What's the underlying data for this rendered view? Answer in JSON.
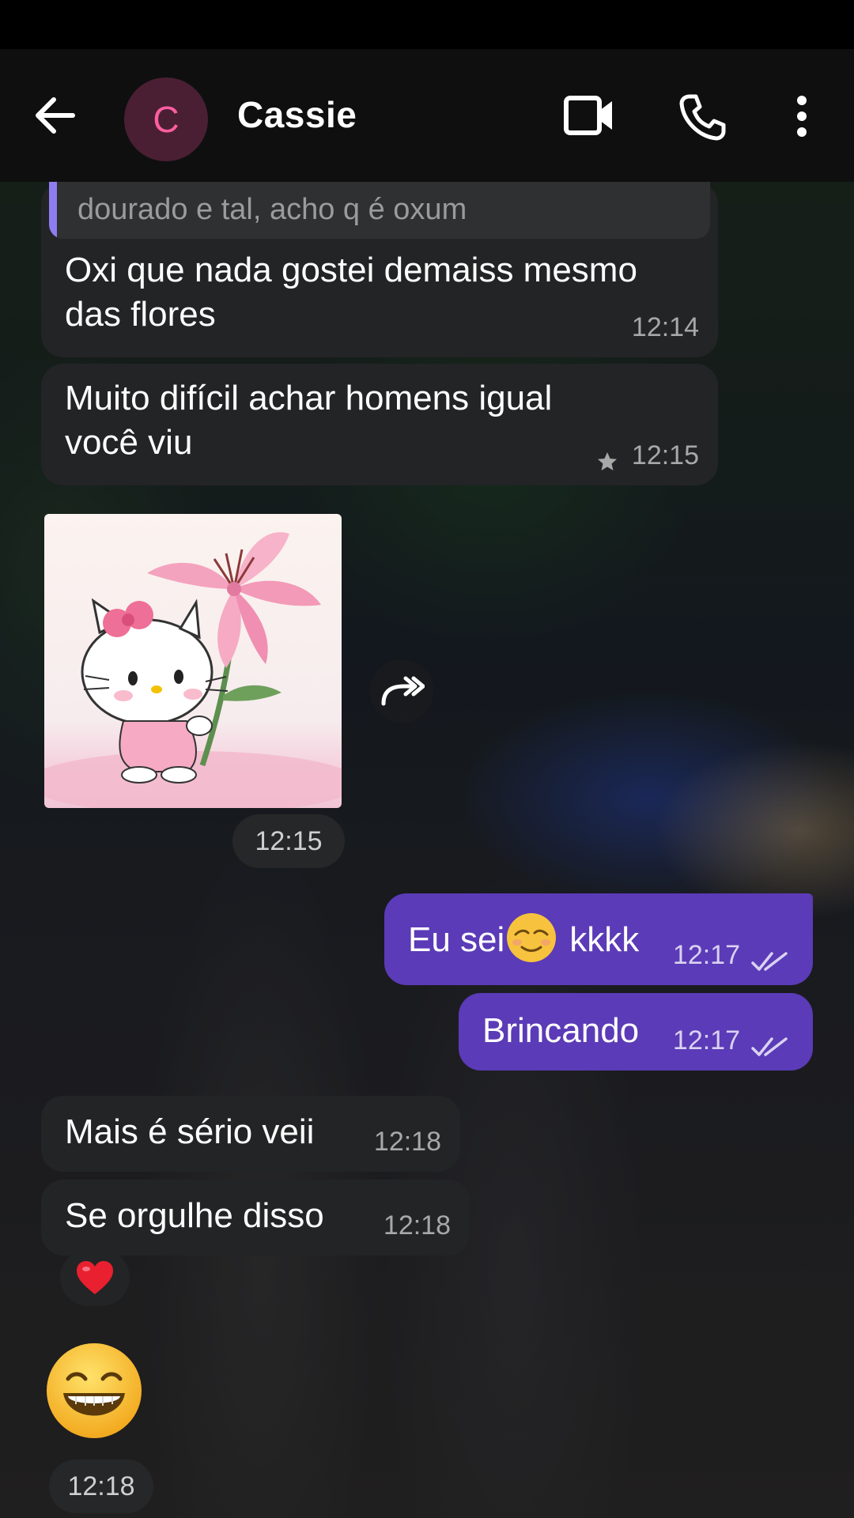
{
  "header": {
    "back_label": "back",
    "avatar_letter": "C",
    "contact_name": "Cassie"
  },
  "messages": [
    {
      "direction": "in",
      "quote_text": "dourado e tal, acho q é oxum",
      "text_line1": "Oxi que nada gostei demaiss mesmo",
      "text_line2": "das flores",
      "time": "12:14"
    },
    {
      "direction": "in",
      "text_line1": "Muito difícil achar homens igual",
      "text_line2": "você viu",
      "time": "12:15",
      "starred": true
    },
    {
      "direction": "in",
      "type": "sticker",
      "sticker": "hello-kitty-lily",
      "time": "12:15"
    },
    {
      "direction": "out",
      "text_a": "Eu sei",
      "emoji": "relieved-face",
      "text_b": "kkkk",
      "time": "12:17",
      "status": "read"
    },
    {
      "direction": "out",
      "text": "Brincando",
      "time": "12:17",
      "status": "read"
    },
    {
      "direction": "in",
      "text": "Mais é sério veii",
      "time": "12:18"
    },
    {
      "direction": "in",
      "text": "Se orgulhe disso",
      "time": "12:18",
      "reaction": "heart"
    },
    {
      "direction": "in",
      "type": "emoji",
      "emoji": "grinning-face",
      "time": "12:18"
    }
  ],
  "colors": {
    "incoming_bubble": "#232425",
    "outgoing_bubble": "#5b3bb7",
    "quote_accent": "#8e7cf0",
    "avatar_bg": "#4a1f33",
    "avatar_letter": "#ff5ea0"
  }
}
